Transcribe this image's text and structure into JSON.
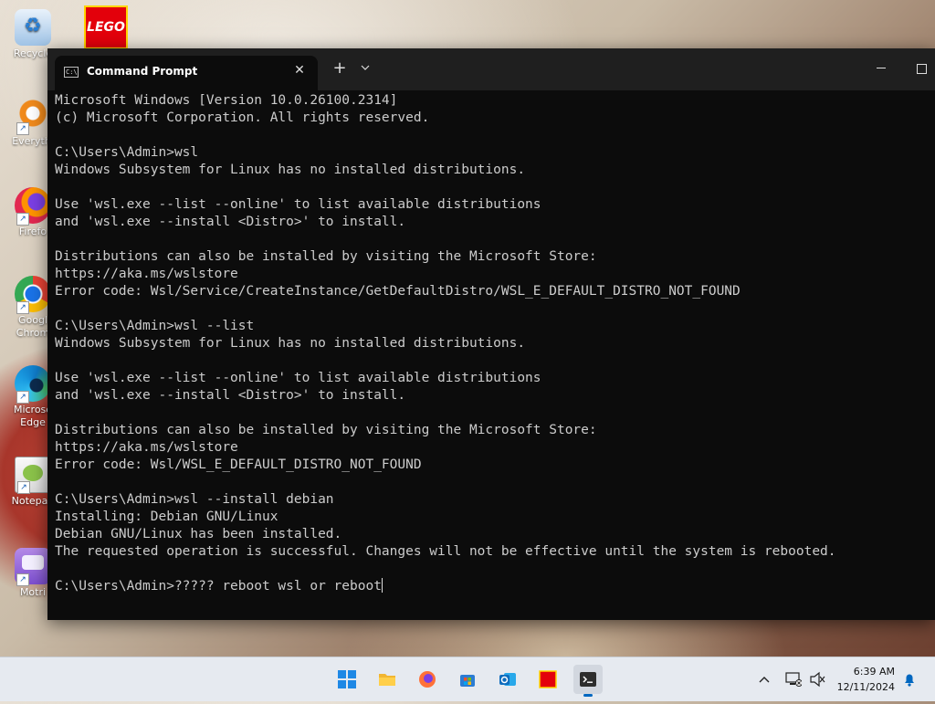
{
  "desktop": {
    "icons": [
      {
        "label": "Recycle",
        "icon": "recycle-bin-icon"
      },
      {
        "label": "Everythi",
        "icon": "everything-search-icon"
      },
      {
        "label": "Firefo",
        "icon": "firefox-icon"
      },
      {
        "label": "Googl Chrom",
        "icon": "chrome-icon"
      },
      {
        "label": "Microso Edge",
        "icon": "edge-icon"
      },
      {
        "label": "Notepad",
        "icon": "notepadpp-icon"
      },
      {
        "label": "Motri",
        "icon": "motrix-icon"
      }
    ],
    "lego_logo": "LEGO"
  },
  "window": {
    "tab_title": "Command Prompt",
    "tab_close": "✕",
    "new_tab": "+",
    "tab_dropdown": "⌄"
  },
  "console": {
    "lines": [
      "Microsoft Windows [Version 10.0.26100.2314]",
      "(c) Microsoft Corporation. All rights reserved.",
      "",
      "C:\\Users\\Admin>wsl",
      "Windows Subsystem for Linux has no installed distributions.",
      "",
      "Use 'wsl.exe --list --online' to list available distributions",
      "and 'wsl.exe --install <Distro>' to install.",
      "",
      "Distributions can also be installed by visiting the Microsoft Store:",
      "https://aka.ms/wslstore",
      "Error code: Wsl/Service/CreateInstance/GetDefaultDistro/WSL_E_DEFAULT_DISTRO_NOT_FOUND",
      "",
      "C:\\Users\\Admin>wsl --list",
      "Windows Subsystem for Linux has no installed distributions.",
      "",
      "Use 'wsl.exe --list --online' to list available distributions",
      "and 'wsl.exe --install <Distro>' to install.",
      "",
      "Distributions can also be installed by visiting the Microsoft Store:",
      "https://aka.ms/wslstore",
      "Error code: Wsl/WSL_E_DEFAULT_DISTRO_NOT_FOUND",
      "",
      "C:\\Users\\Admin>wsl --install debian",
      "Installing: Debian GNU/Linux",
      "Debian GNU/Linux has been installed.",
      "The requested operation is successful. Changes will not be effective until the system is rebooted.",
      ""
    ],
    "input_line": "C:\\Users\\Admin>????? reboot wsl or reboot"
  },
  "taskbar": {
    "apps": [
      {
        "name": "start",
        "icon": "windows-start-icon",
        "color": "#1e88e5"
      },
      {
        "name": "file-explorer",
        "icon": "folder-icon",
        "color": "#f2b632"
      },
      {
        "name": "firefox",
        "icon": "firefox-icon",
        "color": "#ff7139"
      },
      {
        "name": "microsoft-store",
        "icon": "store-icon",
        "color": "#2b7cd3"
      },
      {
        "name": "outlook",
        "icon": "outlook-icon",
        "color": "#0f6cbd"
      },
      {
        "name": "lego",
        "icon": "lego-icon",
        "color": "#e3000b"
      },
      {
        "name": "terminal",
        "icon": "terminal-icon",
        "color": "#2d2d2d"
      }
    ],
    "time": "6:39 AM",
    "date": "12/11/2024"
  }
}
